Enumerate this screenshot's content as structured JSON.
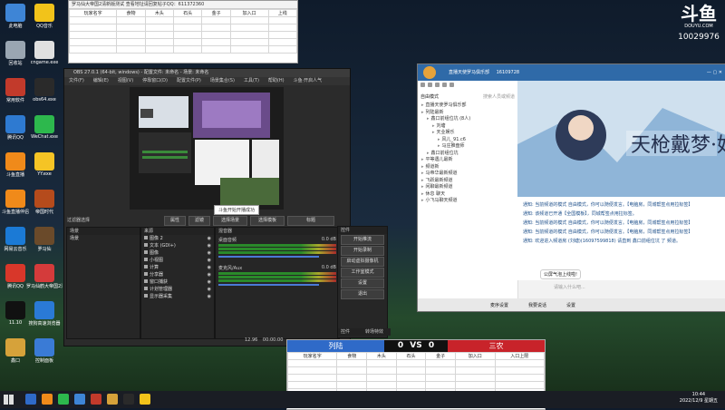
{
  "desktop_icons": [
    {
      "label": "此电脑",
      "color": "#3e85d6"
    },
    {
      "label": "QQ音乐",
      "color": "#f2c31a"
    },
    {
      "label": "回收站",
      "color": "#9aa6b2"
    },
    {
      "label": "cngame.exe",
      "color": "#e0e0e0"
    },
    {
      "label": "常用软件",
      "color": "#c23a2b"
    },
    {
      "label": "obs64.exe",
      "color": "#2a2a2a"
    },
    {
      "label": "腾讯QQ",
      "color": "#2e7ad1"
    },
    {
      "label": "WeChat.exe",
      "color": "#2db84d"
    },
    {
      "label": "斗鱼直播",
      "color": "#f08a1a"
    },
    {
      "label": "YY.exe",
      "color": "#f5c425"
    },
    {
      "label": "斗鱼直播伴侣",
      "color": "#f08a1a"
    },
    {
      "label": "帝国时代",
      "color": "#b54b1c"
    },
    {
      "label": "网易云音乐",
      "color": "#1b7ad6"
    },
    {
      "label": "罗马仙",
      "color": "#6a4a2a"
    },
    {
      "label": "腾讯QQ",
      "color": "#d8372a"
    },
    {
      "label": "罗马仙鹤大帝国2清新版",
      "color": "#d43b3b"
    },
    {
      "label": "11.10",
      "color": "#111111"
    },
    {
      "label": "搜狗高速浏览器",
      "color": "#2a7ad6"
    },
    {
      "label": "鑫口",
      "color": "#d6a23a"
    },
    {
      "label": "控制面板",
      "color": "#3a7bd6"
    }
  ],
  "top_sheet": {
    "title": "罗马仙大帝国2清新版测试  查看地址请回复帖子QQ：611372360",
    "headers": [
      "玩家名字",
      "食物",
      "木头",
      "石头",
      "金子",
      "加入口",
      "上线"
    ]
  },
  "obs": {
    "title": "OBS 27.0.1 (64-bit, windows) - 配置文件: 未命名 - 场景: 未命名",
    "menu": [
      "文件(F)",
      "编辑(E)",
      "视图(V)",
      "停靠窗口(D)",
      "配置文件(P)",
      "场景集合(S)",
      "工具(T)",
      "帮助(H)",
      "斗鱼·开启人气"
    ],
    "toast": "斗鱼开始开播成功",
    "filter_label": "过滤器选择",
    "properties": "属性",
    "filters": "滤镜",
    "scene_btn1": "选择场景",
    "scene_btn2": "选择模板",
    "title_field": "标题",
    "docks": {
      "scenes": "场景",
      "sources": "来源",
      "mixer": "混音器",
      "controls": "控件"
    },
    "scenes": [
      "场景"
    ],
    "sources": [
      "图像 2",
      "文本 (GDI+)",
      "图像",
      "小视图",
      "计算",
      "分享器",
      "窗口捕获",
      "计划管理器",
      "显示器采集"
    ],
    "mixer": [
      {
        "name": "桌面音频",
        "db": "0.0 dB"
      },
      {
        "name": "麦克风/Aux",
        "db": "0.0 dB"
      }
    ],
    "controls": [
      "开始推流",
      "开始录制",
      "启动虚拟摄像机",
      "工作室模式",
      "设置",
      "退出"
    ],
    "status": {
      "fps": "12.96",
      "time": "00:00:00"
    },
    "tabs": [
      "控件",
      "转场特效"
    ]
  },
  "douyu": {
    "title": "直播天使罗马俱乐部",
    "room": "16109728",
    "user_count": "10029976",
    "search_placeholder": "搜索人员或频道",
    "mode": "自由模式",
    "tree": [
      "直播天使罗马俱乐部",
      "列陆最新",
      "鑫口前组位坑 (8人)",
      "刘塘",
      "天业娱乐",
      "风儿_91.c6",
      "马庄推盘师",
      "鑫口前组位坑",
      "平等遇儿最新",
      "频道新",
      "马帝华最新频道",
      "飞跃最新频道",
      "闲聊最新频道",
      "休息 聊天",
      "小飞马聊天频道"
    ],
    "chat": [
      "通知: 当前频道的模式 自由模式，你可以随便发言。【电脑房，同城帮签点用拉标签】",
      "通知: 该频道已开通【全国模板】，同城帮签点用拉标签。",
      "通知: 当前频道的模式 自由模式，你可以随便发言。【电脑房，同城帮签点用拉标签】",
      "通知: 当前频道的模式 自由模式，你可以随便发言。【电脑房，同城帮签点用拉标签】",
      "通知: 欢迎进入频道房 (刘塘)(16097599818) 请直到 鑫口前组位坑 了 频道。"
    ],
    "bubble": "公屏气泡上线啦!",
    "input_placeholder": "请输入什么吧...",
    "footer": [
      "麦序设置",
      "我要说话",
      "设置"
    ],
    "logo_text": "斗鱼",
    "logo_sub": "DOUYU.COM"
  },
  "versus": {
    "left": "列陆",
    "right": "三农",
    "score_left": "0",
    "score_right": "0",
    "vs": "VS",
    "headers": [
      "玩家名字",
      "食物",
      "木头",
      "石头",
      "金子",
      "加入口",
      "入口上限"
    ]
  },
  "taskbar": {
    "time": "10:44",
    "date": "2022/12/9 星期五"
  }
}
